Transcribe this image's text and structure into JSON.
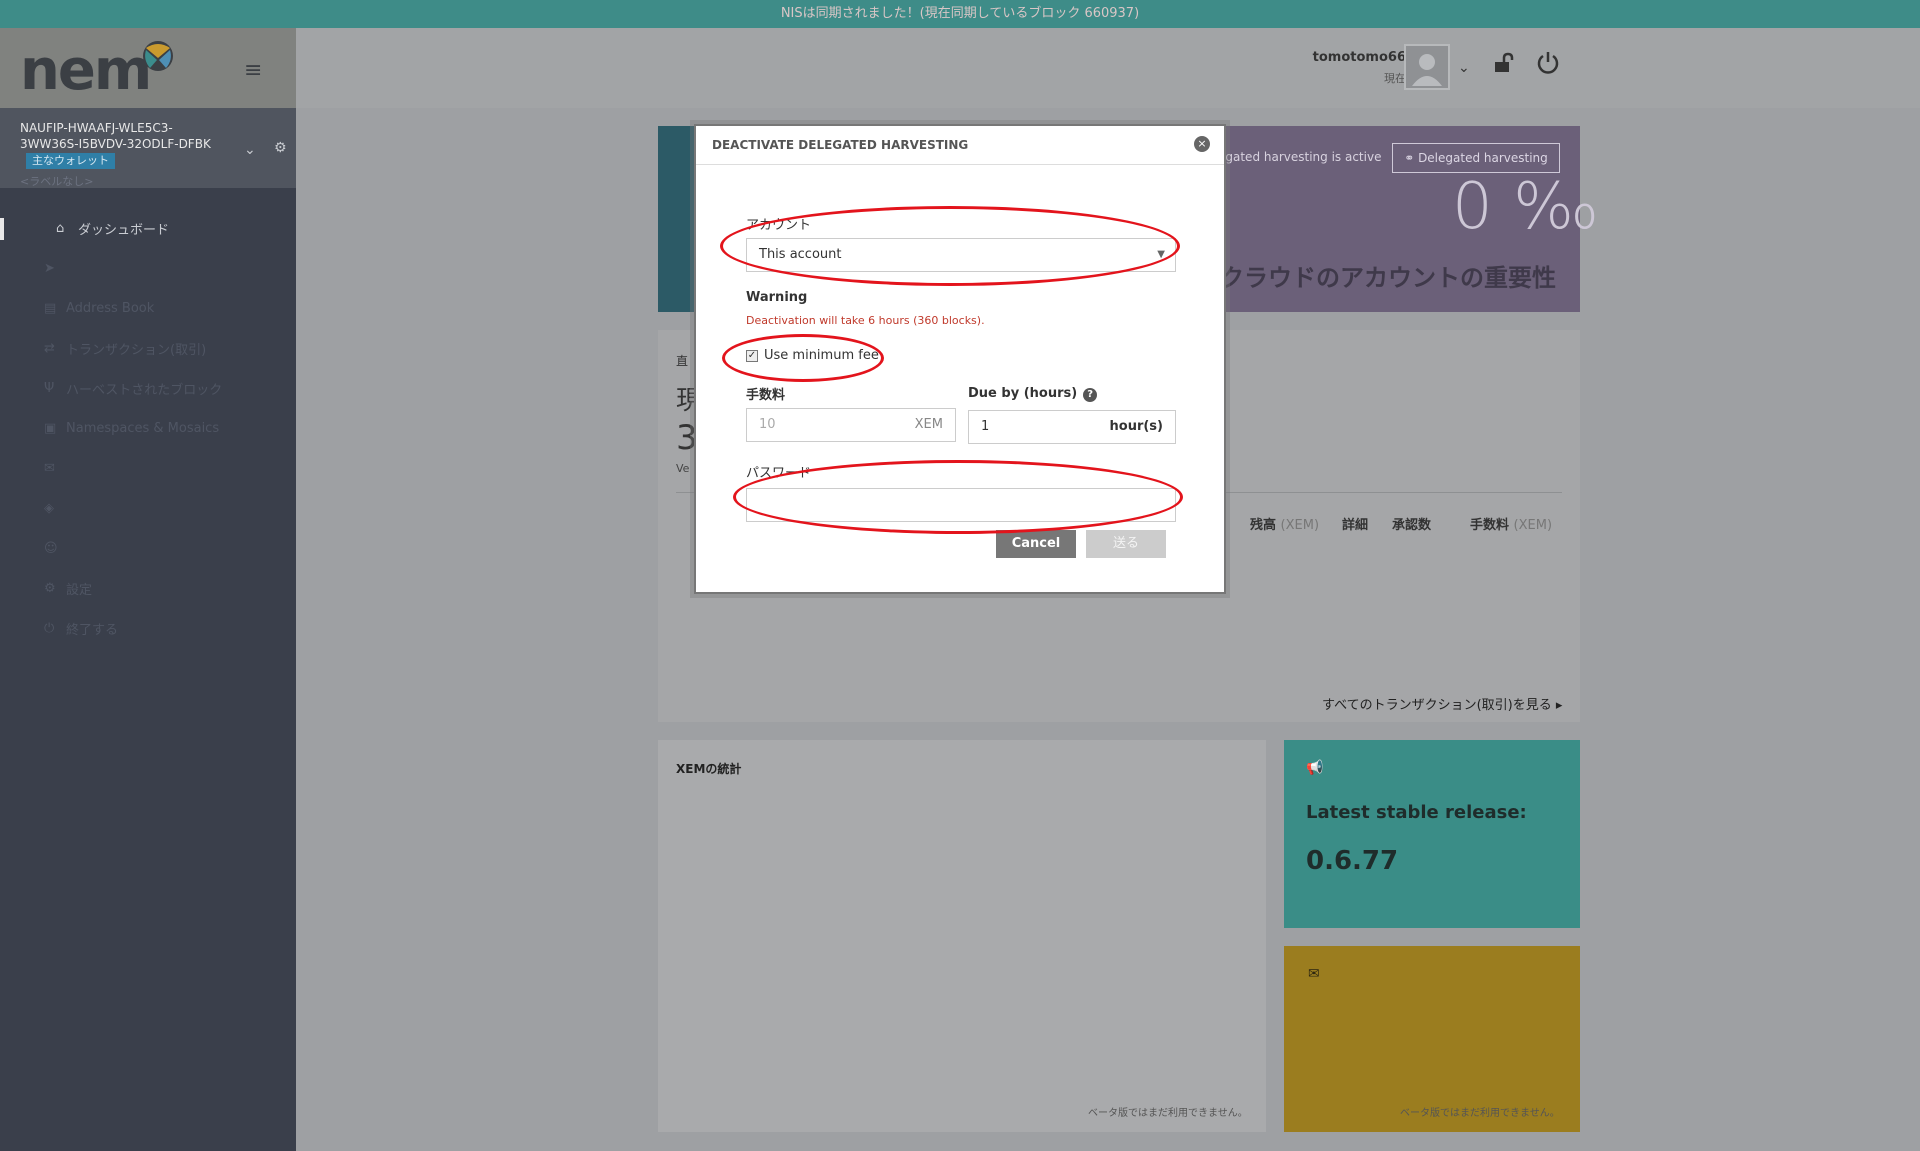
{
  "sync_bar": {
    "text": "NISは同期されました！(現在同期しているブロック 660937)"
  },
  "sidebar": {
    "brand": "nem",
    "wallet": {
      "address": "NAUFIP-HWAAFJ-WLE5C3-3WW36S-I5BVDV-32ODLF-DFBK",
      "badge": "主なウォレット",
      "label": "<ラベルなし>"
    },
    "nav": [
      {
        "label": "ダッシュボード",
        "icon": "home-icon"
      },
      {
        "label": "",
        "icon": "send-icon"
      },
      {
        "label": "Address Book",
        "icon": "book-icon"
      },
      {
        "label": "トランザクション(取引)",
        "icon": "exchange-icon"
      },
      {
        "label": "ハーベストされたブロック",
        "icon": "cutlery-icon"
      },
      {
        "label": "Namespaces & Mosaics",
        "icon": "briefcase-icon"
      },
      {
        "label": "",
        "icon": "envelope-icon"
      },
      {
        "label": "",
        "icon": "tag-icon"
      },
      {
        "label": "",
        "icon": "user-icon"
      },
      {
        "label": "設定",
        "icon": "gears-icon"
      },
      {
        "label": "終了する",
        "icon": "power-icon"
      }
    ]
  },
  "header": {
    "username": "tomotomo66",
    "status": "現在"
  },
  "dashboard": {
    "delegated_active": "egated harvesting is active",
    "delegated_button": "Delegated harvesting",
    "importance_value": "0 ‰",
    "importance_label": "クラウドのアカウントの重要性",
    "tx_card_label": "直",
    "tx_card_big": "現",
    "tx_card_number": "3",
    "tx_card_ver": "Ve",
    "tx_columns": [
      {
        "label": "残高",
        "muted": "(XEM)"
      },
      {
        "label": "詳細",
        "muted": ""
      },
      {
        "label": "承認数",
        "muted": ""
      },
      {
        "label": "手数料",
        "muted": "(XEM)"
      }
    ],
    "see_all": "すべてのトランザクション(取引)を見る",
    "stats_title": "XEMの統計",
    "beta_note": "ベータ版ではまだ利用できません。",
    "release_title": "Latest stable release:",
    "release_version": "0.6.77"
  },
  "modal": {
    "title": "DEACTIVATE DELEGATED HARVESTING",
    "account_label": "アカウント",
    "account_value": "This account",
    "warning_label": "Warning",
    "warning_text": "Deactivation will take 6 hours (360 blocks).",
    "min_fee_label": "Use minimum fee",
    "min_fee_checked": true,
    "fee_label": "手数料",
    "fee_value": "10",
    "fee_unit": "XEM",
    "due_label": "Due by (hours)",
    "due_value": "1",
    "due_unit": "hour(s)",
    "password_label": "パスワード",
    "password_value": "",
    "cancel_label": "Cancel",
    "send_label": "送る"
  },
  "colors": {
    "sync_bar": "#3e8c88",
    "sidebar": "#3a3f4b",
    "annotation": "#e3141c",
    "warning": "#c0392b"
  }
}
